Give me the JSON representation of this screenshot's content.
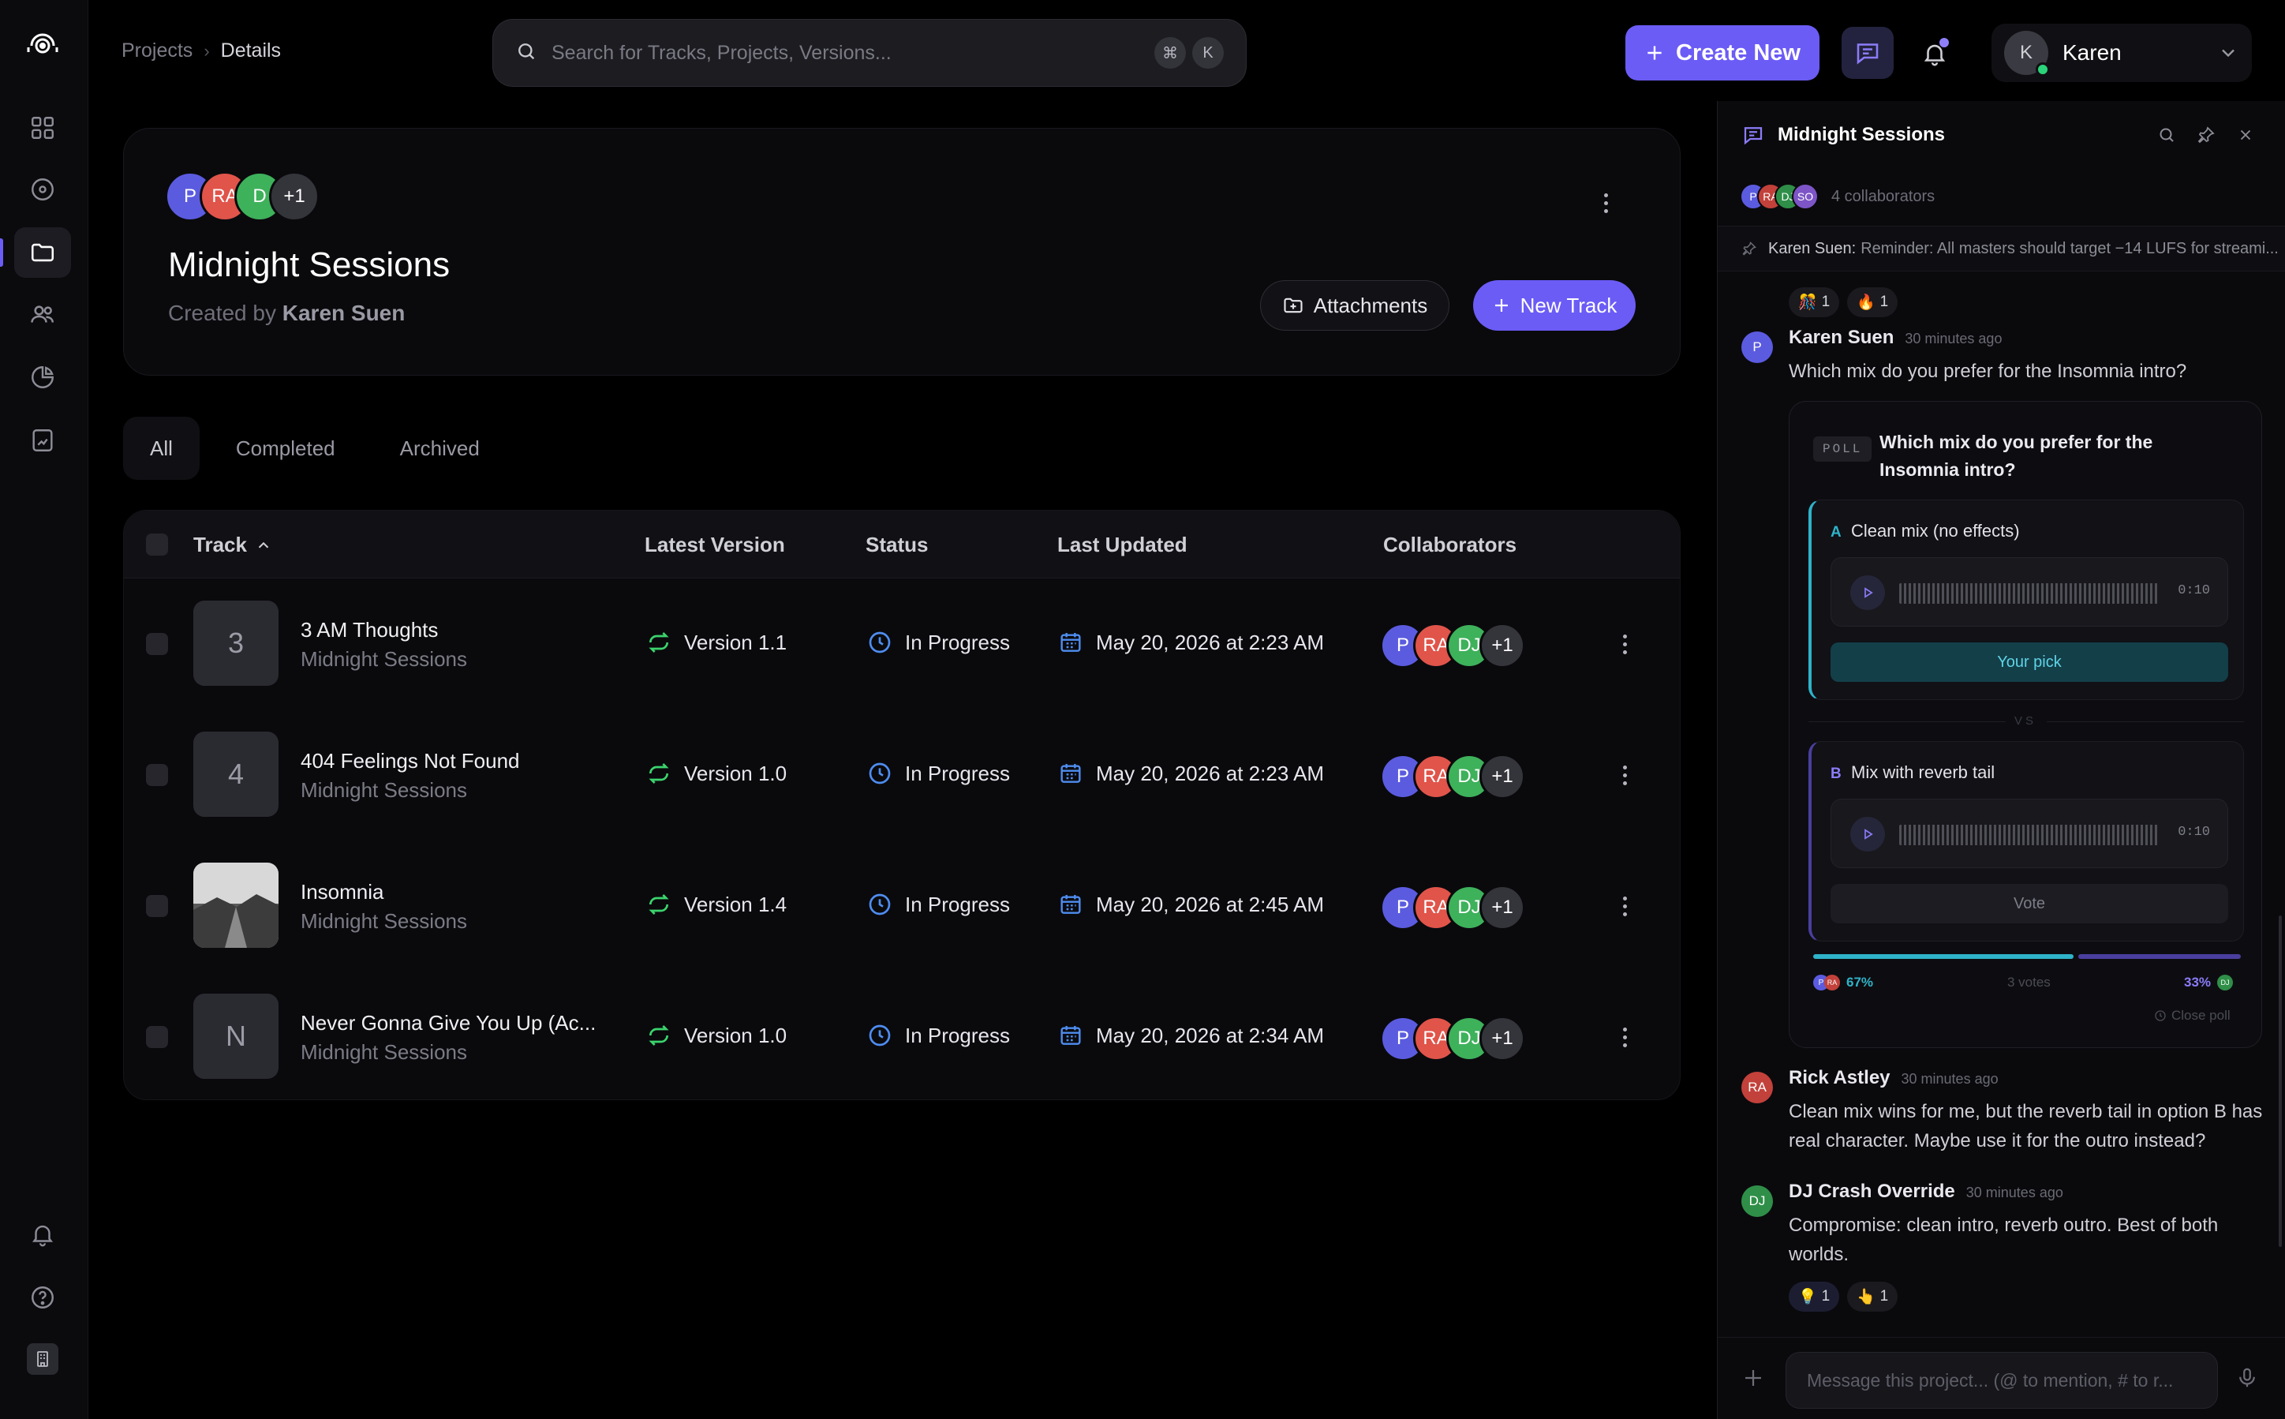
{
  "breadcrumb": {
    "projects": "Projects",
    "separator": "›",
    "details": "Details"
  },
  "search": {
    "placeholder": "Search for Tracks, Projects, Versions...",
    "key1": "⌘",
    "key2": "K"
  },
  "header": {
    "create_label": "Create New",
    "user_initial": "K",
    "user_name": "Karen"
  },
  "project": {
    "title": "Midnight Sessions",
    "created_by_prefix": "Created by",
    "created_by": "Karen Suen",
    "avatars": [
      {
        "initials": "P",
        "color": "#5b5be0"
      },
      {
        "initials": "RA",
        "color": "#e0544a"
      },
      {
        "initials": "D",
        "color": "#3eb15b"
      },
      {
        "initials": "+1",
        "color": "#34343b"
      }
    ],
    "attachments_label": "Attachments",
    "new_track_label": "New Track"
  },
  "tabs": [
    "All",
    "Completed",
    "Archived"
  ],
  "table": {
    "headers": {
      "track": "Track",
      "version": "Latest Version",
      "status": "Status",
      "updated": "Last Updated",
      "collaborators": "Collaborators"
    },
    "rows": [
      {
        "thumb": "3",
        "name": "3 AM Thoughts",
        "project": "Midnight Sessions",
        "version": "Version 1.1",
        "status": "In Progress",
        "updated": "May 20, 2026 at 2:23 AM"
      },
      {
        "thumb": "4",
        "name": "404 Feelings Not Found",
        "project": "Midnight Sessions",
        "version": "Version 1.0",
        "status": "In Progress",
        "updated": "May 20, 2026 at 2:23 AM"
      },
      {
        "thumb": "",
        "name": "Insomnia",
        "project": "Midnight Sessions",
        "version": "Version 1.4",
        "status": "In Progress",
        "updated": "May 20, 2026 at 2:45 AM"
      },
      {
        "thumb": "N",
        "name": "Never Gonna Give You Up (Ac...",
        "project": "Midnight Sessions",
        "version": "Version 1.0",
        "status": "In Progress",
        "updated": "May 20, 2026 at 2:34 AM"
      }
    ],
    "collab_avatars": [
      {
        "initials": "P",
        "color": "#5b5be0"
      },
      {
        "initials": "RA",
        "color": "#e0544a"
      },
      {
        "initials": "DJ",
        "color": "#3eb15b"
      },
      {
        "initials": "+1",
        "color": "#34343b"
      }
    ]
  },
  "chat": {
    "title": "Midnight Sessions",
    "collaborators_label": "4 collaborators",
    "collab_avatars": [
      {
        "initials": "P",
        "color": "#5b5be0"
      },
      {
        "initials": "RA",
        "color": "#c2413a"
      },
      {
        "initials": "DJ",
        "color": "#2f8f48"
      },
      {
        "initials": "SO",
        "color": "#7d55c7"
      }
    ],
    "pinned_author": "Karen Suen:",
    "pinned_text": "Reminder: All masters should target −14 LUFS for streami...",
    "top_reactions": [
      {
        "emoji": "🎊",
        "count": "1"
      },
      {
        "emoji": "🔥",
        "count": "1"
      }
    ],
    "messages": [
      {
        "avatar": "P",
        "color": "#5b5be0",
        "name": "Karen Suen",
        "time": "30 minutes ago",
        "text": "Which mix do you prefer for the Insomnia intro?"
      },
      {
        "avatar": "RA",
        "color": "#c2413a",
        "name": "Rick Astley",
        "time": "30 minutes ago",
        "text": "Clean mix wins for me, but the reverb tail in option B has real character. Maybe use it for the outro instead?"
      },
      {
        "avatar": "DJ",
        "color": "#2f8f48",
        "name": "DJ Crash Override",
        "time": "30 minutes ago",
        "text": "Compromise: clean intro, reverb outro. Best of both worlds."
      }
    ],
    "poll": {
      "tag": "POLL",
      "question": "Which mix do you prefer for the Insomnia intro?",
      "option_a": {
        "letter": "A",
        "label": "Clean mix (no effects)",
        "duration": "0:10",
        "button": "Your pick"
      },
      "vs": "VS",
      "option_b": {
        "letter": "B",
        "label": "Mix with reverb tail",
        "duration": "0:10",
        "button": "Vote"
      },
      "a_percent_label": "67%",
      "b_percent_label": "33%",
      "a_share": 0.67,
      "votes": "3 votes",
      "close_label": "Close poll"
    },
    "bottom_reactions": [
      {
        "emoji": "💡",
        "count": "1"
      },
      {
        "emoji": "👆",
        "count": "1"
      }
    ],
    "input_placeholder": "Message this project... (@ to mention, # to r..."
  },
  "colors": {
    "accent": "#6b5cf6",
    "teal": "#2fb3c9",
    "green_icon": "#3bd46d",
    "blue_icon": "#4f8df0"
  }
}
